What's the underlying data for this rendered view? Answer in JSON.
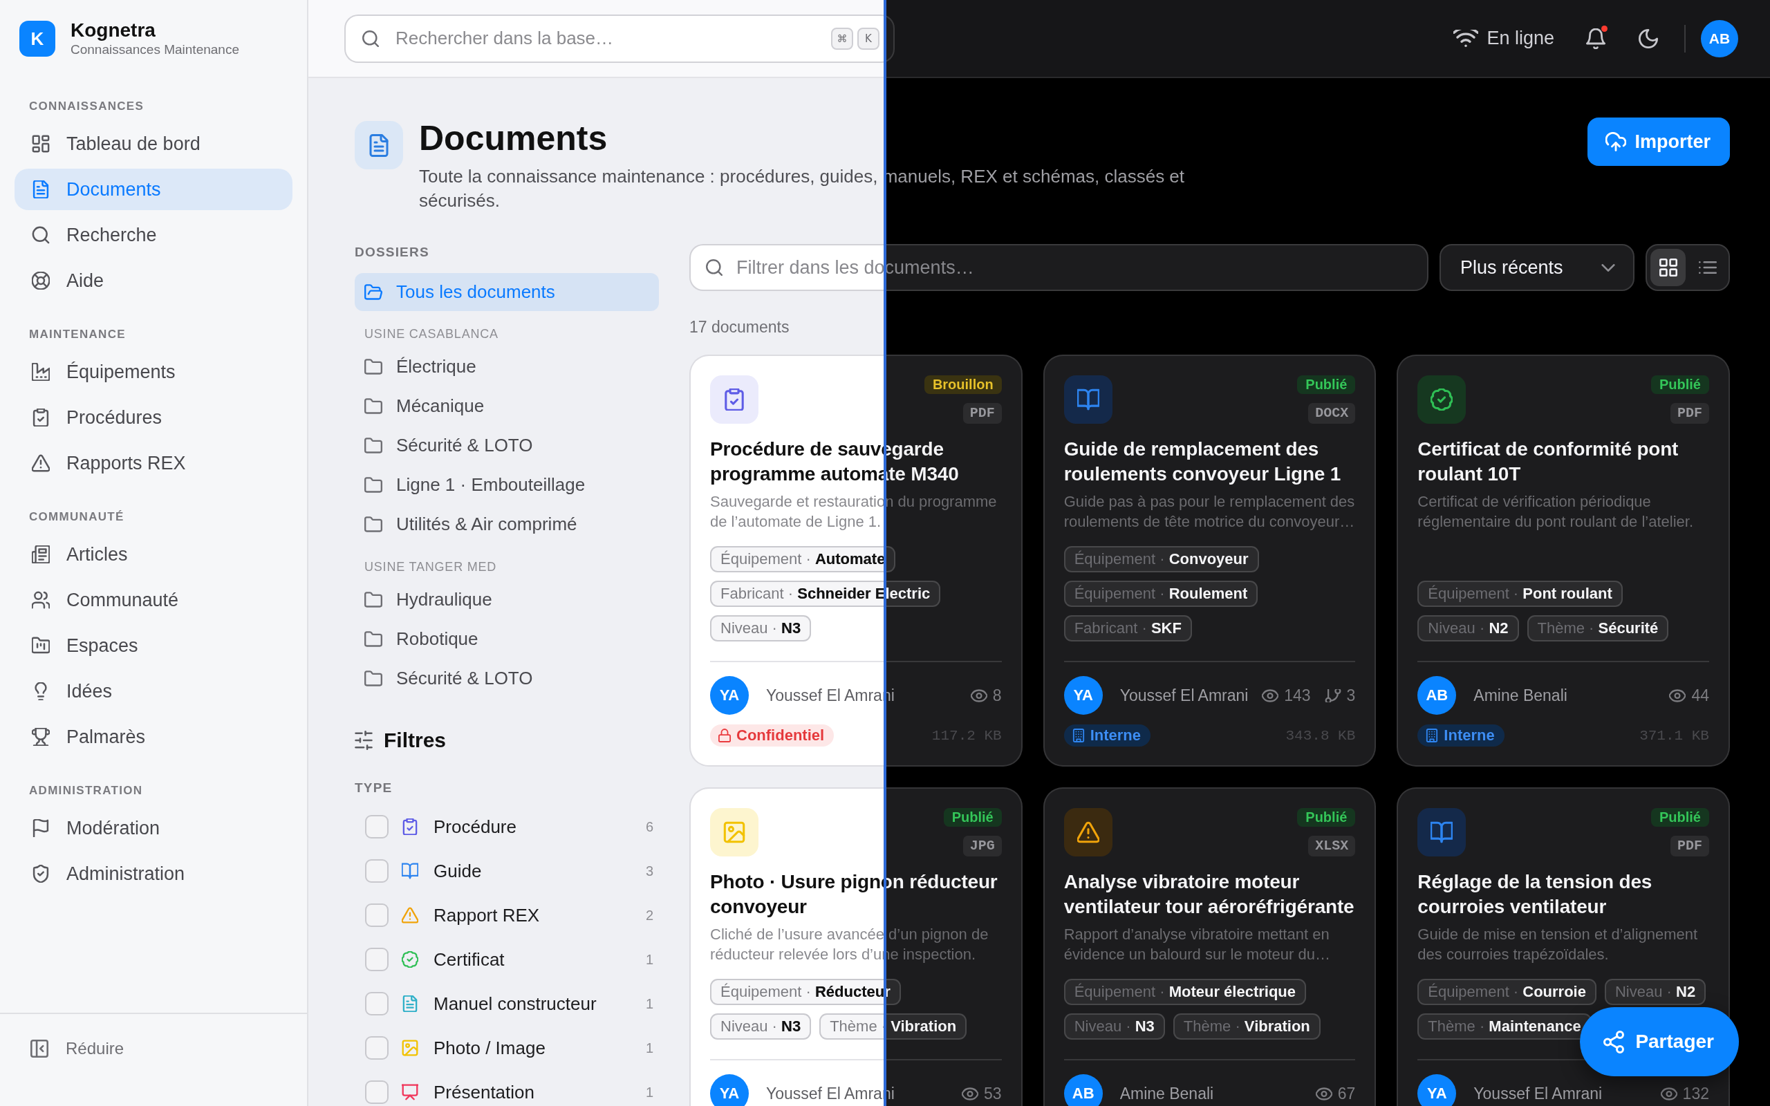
{
  "brand": {
    "logo_letter": "K",
    "name": "Kognetra",
    "tagline": "Connaissances Maintenance"
  },
  "sidebar": {
    "sections": [
      {
        "title": "CONNAISSANCES",
        "items": [
          {
            "kind": "dashboard",
            "label": "Tableau de bord",
            "selected": false
          },
          {
            "kind": "documents",
            "label": "Documents",
            "selected": true
          },
          {
            "kind": "search",
            "label": "Recherche",
            "selected": false
          },
          {
            "kind": "help",
            "label": "Aide",
            "selected": false
          }
        ]
      },
      {
        "title": "MAINTENANCE",
        "items": [
          {
            "kind": "equipment",
            "label": "Équipements",
            "selected": false
          },
          {
            "kind": "procedures",
            "label": "Procédures",
            "selected": false
          },
          {
            "kind": "reports",
            "label": "Rapports REX",
            "selected": false
          }
        ]
      },
      {
        "title": "COMMUNAUTÉ",
        "items": [
          {
            "kind": "articles",
            "label": "Articles",
            "selected": false
          },
          {
            "kind": "community",
            "label": "Communauté",
            "selected": false
          },
          {
            "kind": "spaces",
            "label": "Espaces",
            "selected": false
          },
          {
            "kind": "ideas",
            "label": "Idées",
            "selected": false
          },
          {
            "kind": "ranking",
            "label": "Palmarès",
            "selected": false
          }
        ]
      },
      {
        "title": "ADMINISTRATION",
        "items": [
          {
            "kind": "moderation",
            "label": "Modération",
            "selected": false
          },
          {
            "kind": "admin",
            "label": "Administration",
            "selected": false
          }
        ]
      }
    ],
    "collapse": "Réduire"
  },
  "topbar": {
    "search": {
      "placeholder": "Rechercher dans la base…",
      "shortcut": [
        "⌘",
        "K"
      ]
    },
    "connection": "En ligne",
    "notifications": {
      "unread": true
    },
    "user_initials": "AB"
  },
  "page": {
    "title": "Documents",
    "description": "Toute la connaissance maintenance : procédures, guides, manuels, REX et schémas, classés et sécurisés.",
    "import_button": "Importer"
  },
  "folders": {
    "title": "DOSSIERS",
    "all": {
      "label": "Tous les documents",
      "selected": true
    },
    "groups": [
      {
        "title": "USINE CASABLANCA",
        "items": [
          {
            "label": "Électrique",
            "selected": false
          },
          {
            "label": "Mécanique",
            "selected": false
          },
          {
            "label": "Sécurité & LOTO",
            "selected": false
          },
          {
            "label": "Ligne 1 · Embouteillage",
            "selected": false
          },
          {
            "label": "Utilités & Air comprimé",
            "selected": false
          }
        ]
      },
      {
        "title": "USINE TANGER MED",
        "items": [
          {
            "label": "Hydraulique",
            "selected": false
          },
          {
            "label": "Robotique",
            "selected": false
          },
          {
            "label": "Sécurité & LOTO",
            "selected": false
          }
        ]
      }
    ]
  },
  "filters": {
    "title": "Filtres",
    "groups": [
      {
        "title": "TYPE",
        "options": [
          {
            "kind": "procedure",
            "label": "Procédure",
            "count": "6",
            "checked": false
          },
          {
            "kind": "guide",
            "label": "Guide",
            "count": "3",
            "checked": false
          },
          {
            "kind": "report",
            "label": "Rapport REX",
            "count": "2",
            "checked": false
          },
          {
            "kind": "certificate",
            "label": "Certificat",
            "count": "1",
            "checked": false
          },
          {
            "kind": "manual",
            "label": "Manuel constructeur",
            "count": "1",
            "checked": false
          },
          {
            "kind": "photo",
            "label": "Photo / Image",
            "count": "1",
            "checked": false
          },
          {
            "kind": "presentation",
            "label": "Présentation",
            "count": "1",
            "checked": false
          }
        ]
      }
    ]
  },
  "toolbar": {
    "filter": {
      "placeholder": "Filtrer dans les documents…"
    },
    "sort": "Plus récents",
    "views": [
      {
        "kind": "grid",
        "selected": true
      },
      {
        "kind": "list",
        "selected": false
      }
    ]
  },
  "result_count": "17 documents",
  "documents": [
    {
      "kind": "procedure",
      "status": {
        "kind": "draft",
        "label": "Brouillon"
      },
      "format": "PDF",
      "title": "Procédure de sauvegarde programme automate M340",
      "description": "Sauvegarde et restauration du programme de l’automate de Ligne 1.",
      "tags": [
        "Équipement · **Automate**",
        "Fabricant · **Schneider Electric**",
        "Niveau · **N3**"
      ],
      "author": {
        "initials": "YA",
        "name": "Youssef El Amrani"
      },
      "metrics": [
        {
          "kind": "views",
          "value": "8"
        }
      ],
      "access": {
        "kind": "confidential",
        "label": "Confidentiel"
      },
      "size": "117.2 KB"
    },
    {
      "kind": "guide",
      "status": {
        "kind": "published",
        "label": "Publié"
      },
      "format": "DOCX",
      "title": "Guide de remplacement des roulements convoyeur Ligne 1",
      "description": "Guide pas à pas pour le remplacement des roulements de tête motrice du convoyeur…",
      "tags": [
        "Équipement · **Convoyeur**",
        "Équipement · **Roulement**",
        "Fabricant · **SKF**"
      ],
      "author": {
        "initials": "YA",
        "name": "Youssef El Amrani"
      },
      "metrics": [
        {
          "kind": "views",
          "value": "143"
        },
        {
          "kind": "forks",
          "value": "3"
        }
      ],
      "access": {
        "kind": "internal",
        "label": "Interne"
      },
      "size": "343.8 KB"
    },
    {
      "kind": "certificate",
      "status": {
        "kind": "published",
        "label": "Publié"
      },
      "format": "PDF",
      "title": "Certificat de conformité pont roulant 10T",
      "description": "Certificat de vérification périodique réglementaire du pont roulant de l’atelier.",
      "tags": [
        "Équipement · **Pont roulant**",
        "Niveau · **N2**",
        "Thème · **Sécurité**"
      ],
      "author": {
        "initials": "AB",
        "name": "Amine Benali"
      },
      "metrics": [
        {
          "kind": "views",
          "value": "44"
        }
      ],
      "access": {
        "kind": "internal",
        "label": "Interne"
      },
      "size": "371.1 KB"
    },
    {
      "kind": "photo",
      "status": {
        "kind": "published",
        "label": "Publié"
      },
      "format": "JPG",
      "title": "Photo · Usure pignon réducteur convoyeur",
      "description": "Cliché de l’usure avancée d’un pignon de réducteur relevée lors d’une inspection.",
      "tags": [
        "Équipement · **Réducteur**",
        "Niveau · **N3**",
        "Thème · **Vibration**"
      ],
      "author": {
        "initials": "YA",
        "name": "Youssef El Amrani"
      },
      "metrics": [
        {
          "kind": "views",
          "value": "53"
        }
      ]
    },
    {
      "kind": "report",
      "status": {
        "kind": "published",
        "label": "Publié"
      },
      "format": "XLSX",
      "title": "Analyse vibratoire moteur ventilateur tour aéroréfrigérante",
      "description": "Rapport d’analyse vibratoire mettant en évidence un balourd sur le moteur du…",
      "tags": [
        "Équipement · **Moteur électrique**",
        "Niveau · **N3**",
        "Thème · **Vibration**"
      ],
      "author": {
        "initials": "AB",
        "name": "Amine Benali"
      },
      "metrics": [
        {
          "kind": "views",
          "value": "67"
        }
      ]
    },
    {
      "kind": "guide",
      "status": {
        "kind": "published",
        "label": "Publié"
      },
      "format": "PDF",
      "title": "Réglage de la tension des courroies ventilateur",
      "description": "Guide de mise en tension et d’alignement des courroies trapézoïdales.",
      "tags": [
        "Équipement · **Courroie**",
        "Niveau · **N2**",
        "Thème · **Maintenance**"
      ],
      "author": {
        "initials": "YA",
        "name": "Youssef El Amrani"
      },
      "metrics": [
        {
          "kind": "views",
          "value": "132"
        }
      ]
    }
  ],
  "share_button": "Partager"
}
